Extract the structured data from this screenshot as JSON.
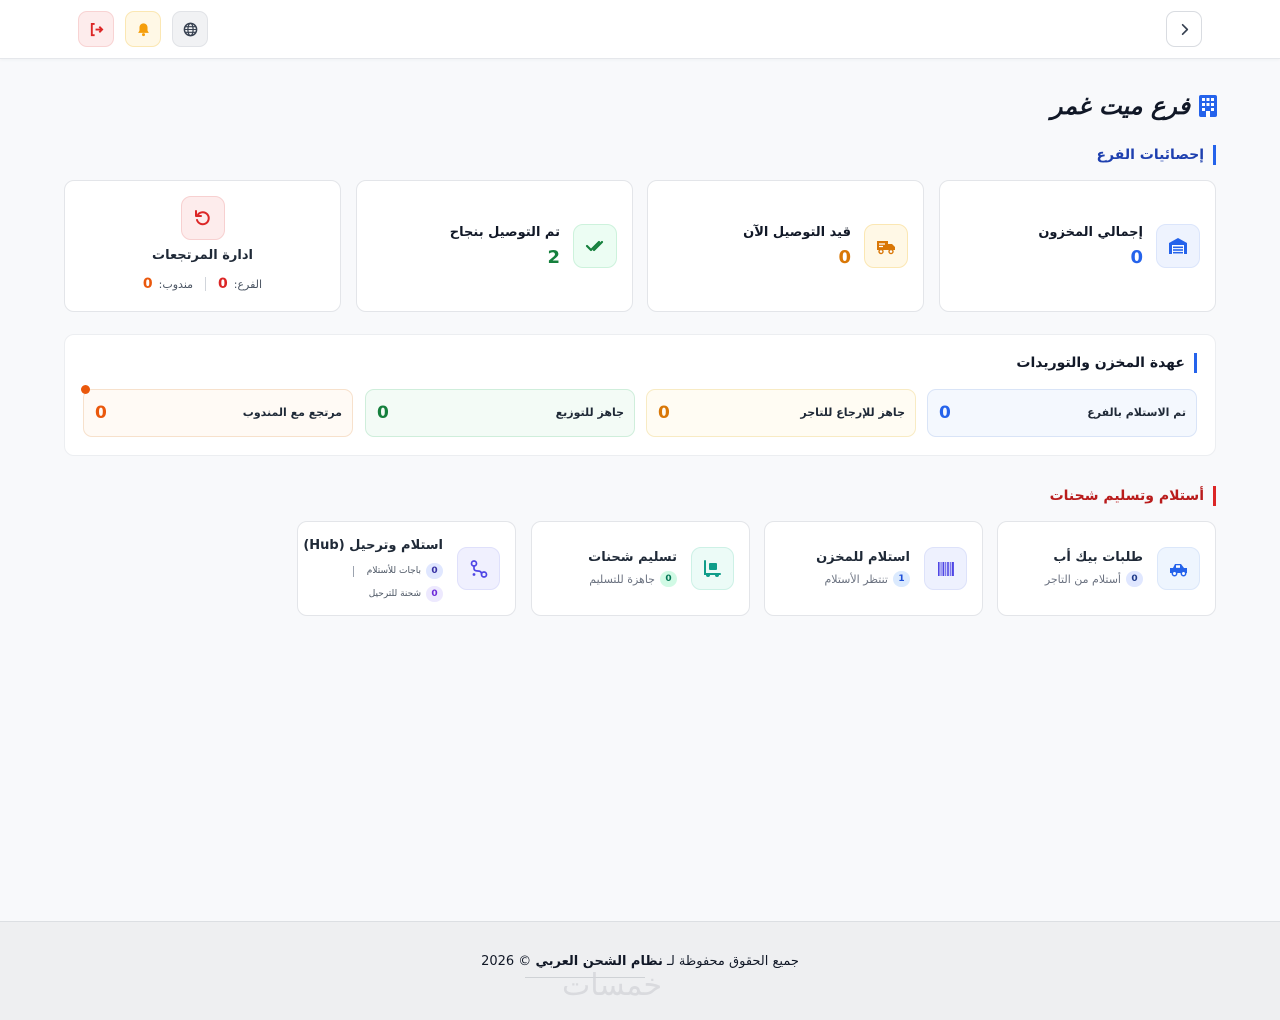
{
  "header": {
    "logout_icon": "logout-icon",
    "notifications_icon": "bell-icon",
    "language_icon": "globe-icon",
    "back_icon": "chevron-right-icon"
  },
  "page": {
    "title": "فرع ميت غمر",
    "title_icon": "building-icon"
  },
  "stats_section": {
    "title": "إحصائيات الفرع",
    "cards": [
      {
        "label": "إجمالي المخزون",
        "value": "0",
        "icon": "warehouse-icon",
        "color": "#2563eb"
      },
      {
        "label": "قيد التوصيل الآن",
        "value": "0",
        "icon": "truck-icon",
        "color": "#d97706"
      },
      {
        "label": "تم التوصيل بنجاح",
        "value": "2",
        "icon": "check-double-icon",
        "color": "#15803d"
      }
    ],
    "returns": {
      "title": "ادارة المرتجعات",
      "branch_label": "الفرع:",
      "branch_value": "0",
      "rep_label": "مندوب:",
      "rep_value": "0",
      "icon": "undo-icon"
    }
  },
  "custody_section": {
    "title": "عهدة المخزن والتوريدات",
    "items": [
      {
        "label": "تم الاستلام بالفرع",
        "value": "0",
        "color": "#2563eb"
      },
      {
        "label": "جاهز للإرجاع للتاجر",
        "value": "0",
        "color": "#d97706"
      },
      {
        "label": "جاهز للتوزيع",
        "value": "0",
        "color": "#15803d"
      },
      {
        "label": "مرتجع مع المندوب",
        "value": "0",
        "color": "#ea580c"
      }
    ]
  },
  "shipments_section": {
    "title": "أستلام وتسليم شحنات",
    "cards": [
      {
        "title": "طلبات بيك أب",
        "badge": "0",
        "subtitle": "أستلام من التاجر",
        "icon": "pickup-truck-icon"
      },
      {
        "title": "استلام للمخزن",
        "badge": "1",
        "subtitle": "تنتظر الأستلام",
        "icon": "barcode-icon"
      },
      {
        "title": "تسليم شحنات",
        "badge": "0",
        "subtitle": "جاهزة للتسليم",
        "icon": "dolly-icon"
      }
    ],
    "hub": {
      "title": "استلام وترحيل (Hub)",
      "row1_badge": "0",
      "row1_label": "باجات للأستلام",
      "row2_badge": "0",
      "row2_label": "شحنة للترحيل",
      "icon": "route-icon"
    }
  },
  "footer": {
    "text_prefix": "جميع الحقوق محفوظة لـ",
    "brand": "نظام الشحن العربي",
    "suffix": "© 2026",
    "watermark": "خمسات"
  }
}
